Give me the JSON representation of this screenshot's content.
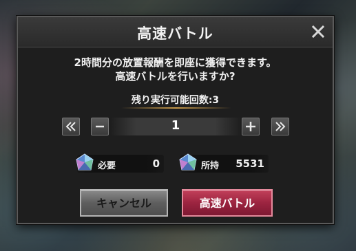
{
  "dialog": {
    "title": "高速バトル",
    "message_line1": "2時間分の放置報酬を即座に獲得できます。",
    "message_line2": "高速バトルを行いますか?",
    "remaining_label": "残り実行可能回数:3"
  },
  "stepper": {
    "value": "1"
  },
  "cost": {
    "required_label": "必要",
    "required_value": "0",
    "owned_label": "所持",
    "owned_value": "5531"
  },
  "buttons": {
    "cancel_label": "キャンセル",
    "confirm_label": "高速バトル"
  },
  "icons": {
    "close": "close-icon",
    "first": "double-chevron-left-icon",
    "minus": "minus-icon",
    "plus": "plus-icon",
    "last": "double-chevron-right-icon",
    "gem": "gem-icon"
  },
  "colors": {
    "confirm_button": "#9c2440",
    "cancel_button": "#6a6a6a",
    "accent_line": "#c89a4a"
  }
}
